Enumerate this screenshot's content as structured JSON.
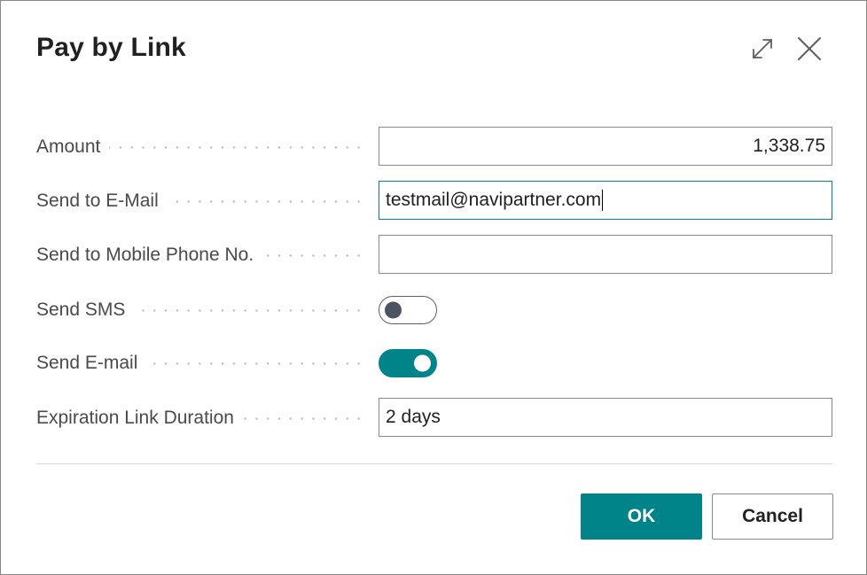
{
  "dialog": {
    "title": "Pay by Link",
    "expand_icon": "expand-icon",
    "close_icon": "close-icon"
  },
  "fields": {
    "amount": {
      "label": "Amount",
      "value": "1,338.75"
    },
    "email": {
      "label": "Send to E-Mail",
      "value": "testmail@navipartner.com"
    },
    "mobile": {
      "label": "Send to Mobile Phone No.",
      "value": ""
    },
    "send_sms": {
      "label": "Send SMS",
      "checked": false
    },
    "send_email": {
      "label": "Send E-mail",
      "checked": true
    },
    "expiration": {
      "label": "Expiration Link Duration",
      "value": "2 days"
    }
  },
  "buttons": {
    "ok": "OK",
    "cancel": "Cancel"
  },
  "colors": {
    "accent": "#008489",
    "text": "#212121",
    "label": "#4a4a4a",
    "border": "#8a8886"
  }
}
